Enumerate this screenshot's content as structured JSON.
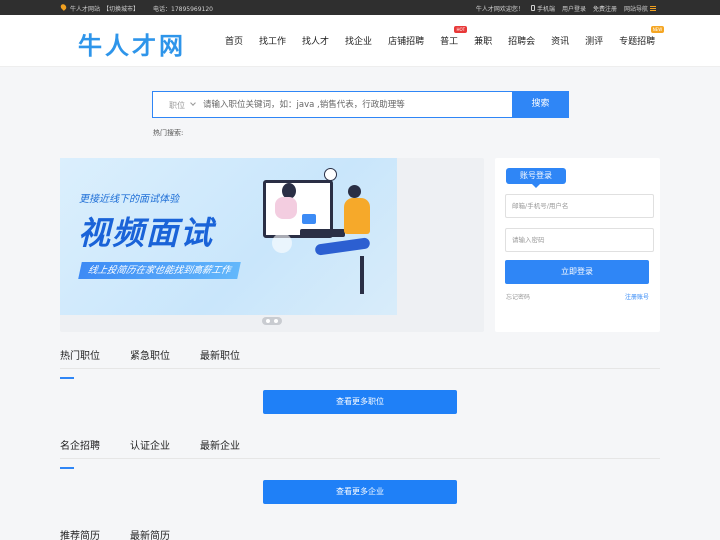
{
  "topbar": {
    "site_name": "牛人才网站",
    "switch_city": "【切换城市】",
    "phone": "电话：17895969120",
    "welcome": "牛人才网欢迎您！",
    "mobile": "手机端",
    "login": "用户登录",
    "register": "免费注册",
    "site_nav": "网站导航"
  },
  "header": {
    "logo": "牛人才网",
    "nav": [
      {
        "label": "首页"
      },
      {
        "label": "找工作"
      },
      {
        "label": "找人才"
      },
      {
        "label": "找企业"
      },
      {
        "label": "店铺招聘"
      },
      {
        "label": "普工",
        "tag": "HOT"
      },
      {
        "label": "兼职"
      },
      {
        "label": "招聘会"
      },
      {
        "label": "资讯"
      },
      {
        "label": "测评"
      },
      {
        "label": "专题招聘",
        "tag": "NEW"
      }
    ]
  },
  "search": {
    "type_label": "职位",
    "placeholder": "请输入职位关键词，如：java ,销售代表，行政助理等",
    "button": "搜索",
    "hot_label": "热门搜索:"
  },
  "banner": {
    "subtitle": "更接近线下的面试体验",
    "title": "视频面试",
    "strip": "线上投简历在家也能找到高薪工作"
  },
  "login": {
    "tab": "账号登录",
    "username_placeholder": "邮箱/手机号/用户名",
    "password_placeholder": "请输入密码",
    "submit": "立即登录",
    "forgot": "忘记密码",
    "register": "注册账号"
  },
  "sections": {
    "jobs": {
      "tabs": [
        "热门职位",
        "紧急职位",
        "最新职位"
      ],
      "more": "查看更多职位"
    },
    "companies": {
      "tabs": [
        "名企招聘",
        "认证企业",
        "最新企业"
      ],
      "more": "查看更多企业"
    },
    "resumes": {
      "tabs": [
        "推荐简历",
        "最新简历"
      ]
    }
  },
  "colors": {
    "accent": "#2f86f6",
    "logo": "#2e95ea",
    "hot_tag": "#e83838",
    "new_tag": "#f5a623"
  }
}
